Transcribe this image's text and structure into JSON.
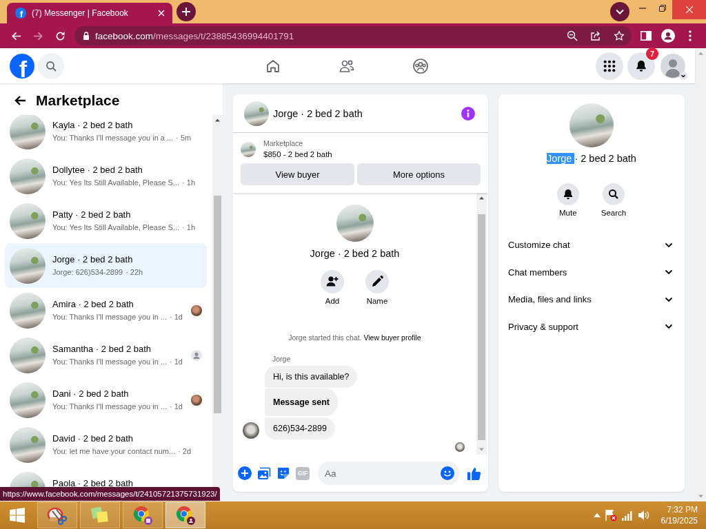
{
  "browser": {
    "tabs": [
      {
        "icon_letter": "f",
        "title": "(7) Messenger | Facebook",
        "selected": true
      }
    ],
    "back_disabled": false,
    "forward_disabled": true,
    "url_host": "facebook.com",
    "url_path": "/messages/t/23885436994401791"
  },
  "nav": {
    "logo_letter": "f",
    "notification_count": "7"
  },
  "sidebar": {
    "title": "Marketplace",
    "conversations": [
      {
        "name": "Kayla · 2 bed 2 bath",
        "preview": "You: Thanks I'll message you in a ...",
        "time": "· 5m",
        "selected": false,
        "seen": false
      },
      {
        "name": "Dollytee · 2 bed 2 bath",
        "preview": "You: Yes Its Still Available, Please S...",
        "time": "· 1h",
        "selected": false,
        "seen": false
      },
      {
        "name": "Patty · 2 bed 2 bath",
        "preview": "You: Yes Its Still Available, Please S...",
        "time": "· 1h",
        "selected": false,
        "seen": false
      },
      {
        "name": "Jorge · 2 bed 2 bath",
        "preview": "Jorge: 626)534-2899",
        "time": "· 22h",
        "selected": true,
        "seen": false
      },
      {
        "name": "Amira · 2 bed 2 bath",
        "preview": "You: Thanks I'll message you in ...",
        "time": "· 1d",
        "selected": false,
        "seen": true,
        "seen_photo": true
      },
      {
        "name": "Samantha · 2 bed 2 bath",
        "preview": "You: Thanks I'll message you in ...",
        "time": "· 1d",
        "selected": false,
        "seen": true,
        "seen_photo": false
      },
      {
        "name": "Dani · 2 bed 2 bath",
        "preview": "You: Thanks I'll message you in ...",
        "time": "· 1d",
        "selected": false,
        "seen": true,
        "seen_photo": true
      },
      {
        "name": "David · 2 bed 2 bath",
        "preview": "You: let me have your contact num...",
        "time": "· 2d",
        "selected": false,
        "seen": false
      },
      {
        "name": "Paola · 2 bed 2 bath",
        "selected": false,
        "seen": false
      }
    ]
  },
  "chat": {
    "title": "Jorge · 2 bed 2 bath",
    "listing": {
      "label": "Marketplace",
      "title": "$850 - 2 bed 2 bath"
    },
    "buttons": [
      "View buyer",
      "More options"
    ],
    "profile_name": "Jorge · 2 bed 2 bath",
    "actions": [
      {
        "kind": "add-person",
        "label": "Add"
      },
      {
        "kind": "pencil",
        "label": "Name"
      }
    ],
    "intro": {
      "text": "Jorge started this chat.",
      "link": "View buyer profile"
    },
    "sender": "Jorge",
    "messages": [
      {
        "kind": "text",
        "text": "Hi, is this available?"
      },
      {
        "kind": "notice",
        "text": "Message sent"
      },
      {
        "kind": "text",
        "text": "626)534-2899"
      }
    ],
    "seen": true,
    "composer": {
      "gif_label": "GIF",
      "placeholder": "Aa"
    }
  },
  "details": {
    "name_parts": [
      {
        "text": "Jorge ",
        "highlighted": true
      },
      {
        "text": "· 2 bed 2 bath",
        "highlighted": false
      }
    ],
    "actions": [
      {
        "kind": "bell",
        "label": "Mute"
      },
      {
        "kind": "search",
        "label": "Search"
      }
    ],
    "sections": [
      {
        "label": "Customize chat",
        "expanded": false
      },
      {
        "label": "Chat members",
        "expanded": false
      },
      {
        "label": "Media, files and links",
        "expanded": false
      },
      {
        "label": "Privacy & support",
        "expanded": false
      }
    ]
  },
  "status_url": "https://www.facebook.com/messages/t/24105721375731923/",
  "taskbar": {
    "apps": [
      {
        "kind": "snipping-tool",
        "active": false
      },
      {
        "kind": "sticky-notes",
        "active": false
      },
      {
        "kind": "chrome",
        "badge_person": false,
        "active": false
      },
      {
        "kind": "chrome",
        "badge_person": true,
        "active": true
      }
    ],
    "time": "7:32 PM",
    "date": "6/19/2025"
  }
}
